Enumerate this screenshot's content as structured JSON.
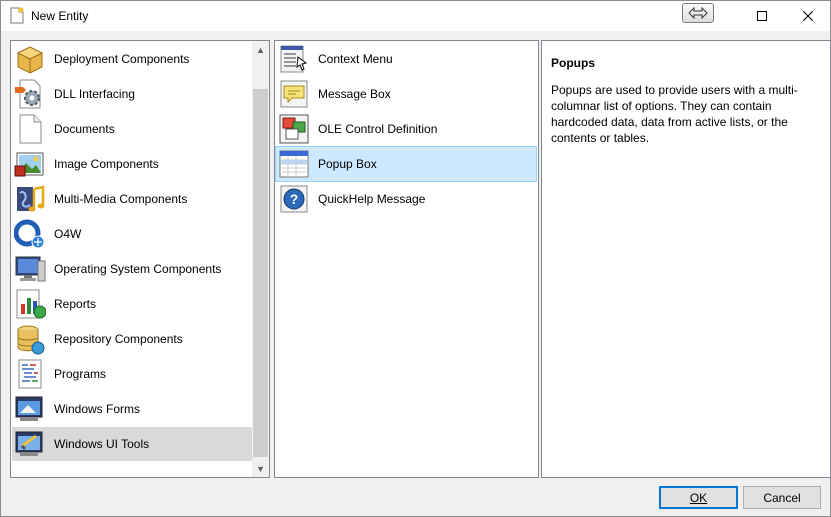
{
  "window": {
    "title": "New Entity",
    "minimize_icon": "resize-arrows-icon",
    "maximize_icon": "maximize-icon",
    "close_icon": "close-icon"
  },
  "categories": {
    "items": [
      {
        "label": "Deployment Components",
        "icon": "package-box-icon"
      },
      {
        "label": "DLL Interfacing",
        "icon": "dll-gear-icon"
      },
      {
        "label": "Documents",
        "icon": "document-icon"
      },
      {
        "label": "Image Components",
        "icon": "image-icon"
      },
      {
        "label": "Multi-Media Components",
        "icon": "music-note-icon"
      },
      {
        "label": "O4W",
        "icon": "o4w-globe-icon"
      },
      {
        "label": "Operating System Components",
        "icon": "monitor-icon"
      },
      {
        "label": "Reports",
        "icon": "report-chart-icon"
      },
      {
        "label": "Repository Components",
        "icon": "database-icon"
      },
      {
        "label": "Programs",
        "icon": "program-code-icon"
      },
      {
        "label": "Windows Forms",
        "icon": "window-form-icon"
      },
      {
        "label": "Windows UI Tools",
        "icon": "ui-tools-icon"
      }
    ],
    "selected_index": 11
  },
  "entities": {
    "items": [
      {
        "label": "Context Menu",
        "icon": "context-menu-icon"
      },
      {
        "label": "Message Box",
        "icon": "message-box-icon"
      },
      {
        "label": "OLE Control Definition",
        "icon": "ole-control-icon"
      },
      {
        "label": "Popup Box",
        "icon": "popup-box-icon"
      },
      {
        "label": "QuickHelp Message",
        "icon": "quickhelp-icon"
      }
    ],
    "selected_index": 3
  },
  "description": {
    "title": "Popups",
    "body": "Popups are used to provide users with a multi-columnar list of options. They can contain hardcoded data, data from active lists, or the contents or tables."
  },
  "buttons": {
    "ok_label": "OK",
    "cancel_label": "Cancel"
  },
  "colors": {
    "selection_blue": "#cce8ff",
    "selection_gray": "#d9d9d9",
    "default_button_border": "#0078d7"
  }
}
